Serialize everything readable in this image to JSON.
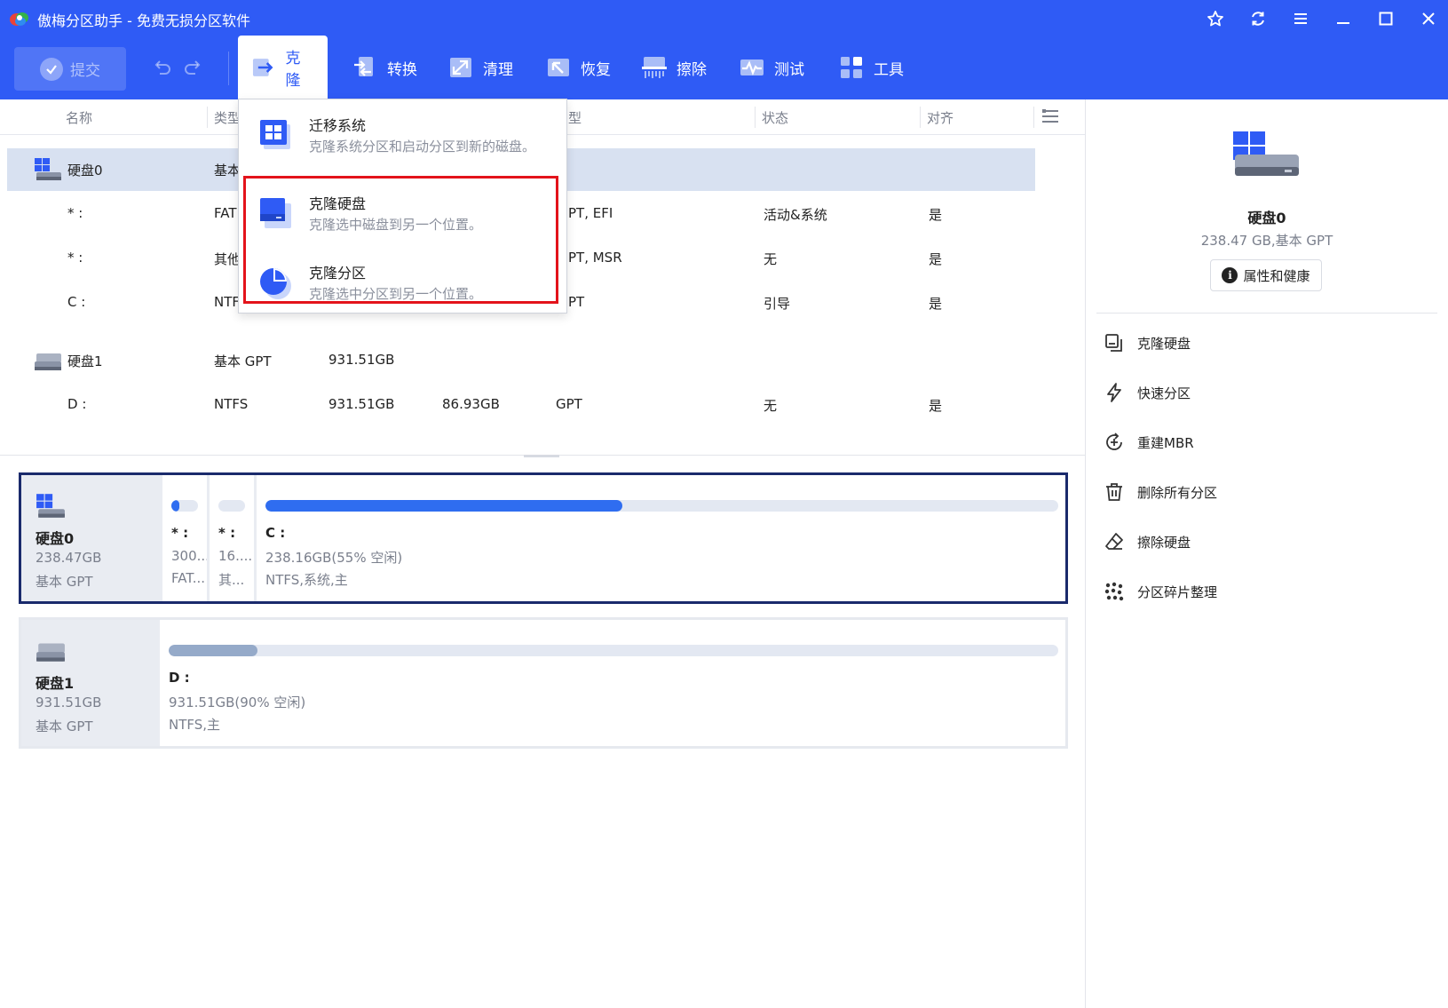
{
  "app": {
    "title": "傲梅分区助手 - 免费无损分区软件"
  },
  "window_controls": [
    "star-icon",
    "refresh-icon",
    "menu-icon",
    "minimize-icon",
    "maximize-icon",
    "close-icon"
  ],
  "toolbar": {
    "submit_label": "提交",
    "tools": [
      {
        "label": "克隆",
        "icon": "clone-icon",
        "active": true
      },
      {
        "label": "转换",
        "icon": "convert-icon",
        "active": false
      },
      {
        "label": "清理",
        "icon": "clean-icon",
        "active": false
      },
      {
        "label": "恢复",
        "icon": "recover-icon",
        "active": false
      },
      {
        "label": "擦除",
        "icon": "wipe-icon",
        "active": false
      },
      {
        "label": "测试",
        "icon": "test-icon",
        "active": false
      },
      {
        "label": "工具",
        "icon": "tools-icon",
        "active": false
      }
    ]
  },
  "columns": {
    "name": "名称",
    "type": "类型",
    "style": "型",
    "status": "状态",
    "aligned": "对齐"
  },
  "rows": [
    {
      "name": "硬盘0",
      "type": "基本",
      "capacity": "",
      "free": "",
      "style": "",
      "status": "",
      "aligned": "",
      "kind": "disk"
    },
    {
      "name": "* :",
      "type": "FAT",
      "capacity": "",
      "free": "",
      "style": "PT, EFI",
      "status": "活动&系统",
      "aligned": "是",
      "kind": "partition"
    },
    {
      "name": "* :",
      "type": "其他",
      "capacity": "",
      "free": "",
      "style": "PT, MSR",
      "status": "无",
      "aligned": "是",
      "kind": "partition"
    },
    {
      "name": "C :",
      "type": "NTF",
      "capacity": "",
      "free": "",
      "style": "PT",
      "status": "引导",
      "aligned": "是",
      "kind": "partition"
    },
    {
      "name": "硬盘1",
      "type": "基本 GPT",
      "capacity": "931.51GB",
      "free": "",
      "style": "",
      "status": "",
      "aligned": "",
      "kind": "disk"
    },
    {
      "name": "D :",
      "type": "NTFS",
      "capacity": "931.51GB",
      "free": "86.93GB",
      "style": "GPT",
      "status": "无",
      "aligned": "是",
      "kind": "partition"
    }
  ],
  "dropdown": {
    "items": [
      {
        "title": "迁移系统",
        "desc": "克隆系统分区和启动分区到新的磁盘。"
      },
      {
        "title": "克隆硬盘",
        "desc": "克隆选中磁盘到另一个位置。"
      },
      {
        "title": "克隆分区",
        "desc": "克隆选中分区到另一个位置。"
      }
    ]
  },
  "disk_cards": [
    {
      "name": "硬盘0",
      "size": "238.47GB",
      "type": "基本 GPT",
      "partitions": [
        {
          "name": "* :",
          "line1": "300...",
          "line2": "FAT...",
          "used": 0.3
        },
        {
          "name": "* :",
          "line1": "16....",
          "line2": "其...",
          "used": 0.0
        },
        {
          "name": "C :",
          "line1": "238.16GB(55% 空闲)",
          "line2": "NTFS,系统,主",
          "used": 0.45
        }
      ]
    },
    {
      "name": "硬盘1",
      "size": "931.51GB",
      "type": "基本 GPT",
      "partitions": [
        {
          "name": "D :",
          "line1": "931.51GB(90% 空闲)",
          "line2": "NTFS,主",
          "used": 0.1
        }
      ]
    }
  ],
  "side": {
    "disk_name": "硬盘0",
    "disk_info": "238.47 GB,基本 GPT",
    "health_button": "属性和健康",
    "operations": [
      {
        "label": "克隆硬盘",
        "icon": "clone-disk-icon"
      },
      {
        "label": "快速分区",
        "icon": "lightning-icon"
      },
      {
        "label": "重建MBR",
        "icon": "rebuild-icon"
      },
      {
        "label": "删除所有分区",
        "icon": "trash-icon"
      },
      {
        "label": "擦除硬盘",
        "icon": "eraser-icon"
      },
      {
        "label": "分区碎片整理",
        "icon": "defrag-icon"
      }
    ]
  },
  "colors": {
    "accent": "#2f5bf5",
    "selected_row": "#d8e1f1",
    "highlight": "#e3131b",
    "used_bar_c": "#2f6df0",
    "used_bar_d": "#95aac9"
  }
}
